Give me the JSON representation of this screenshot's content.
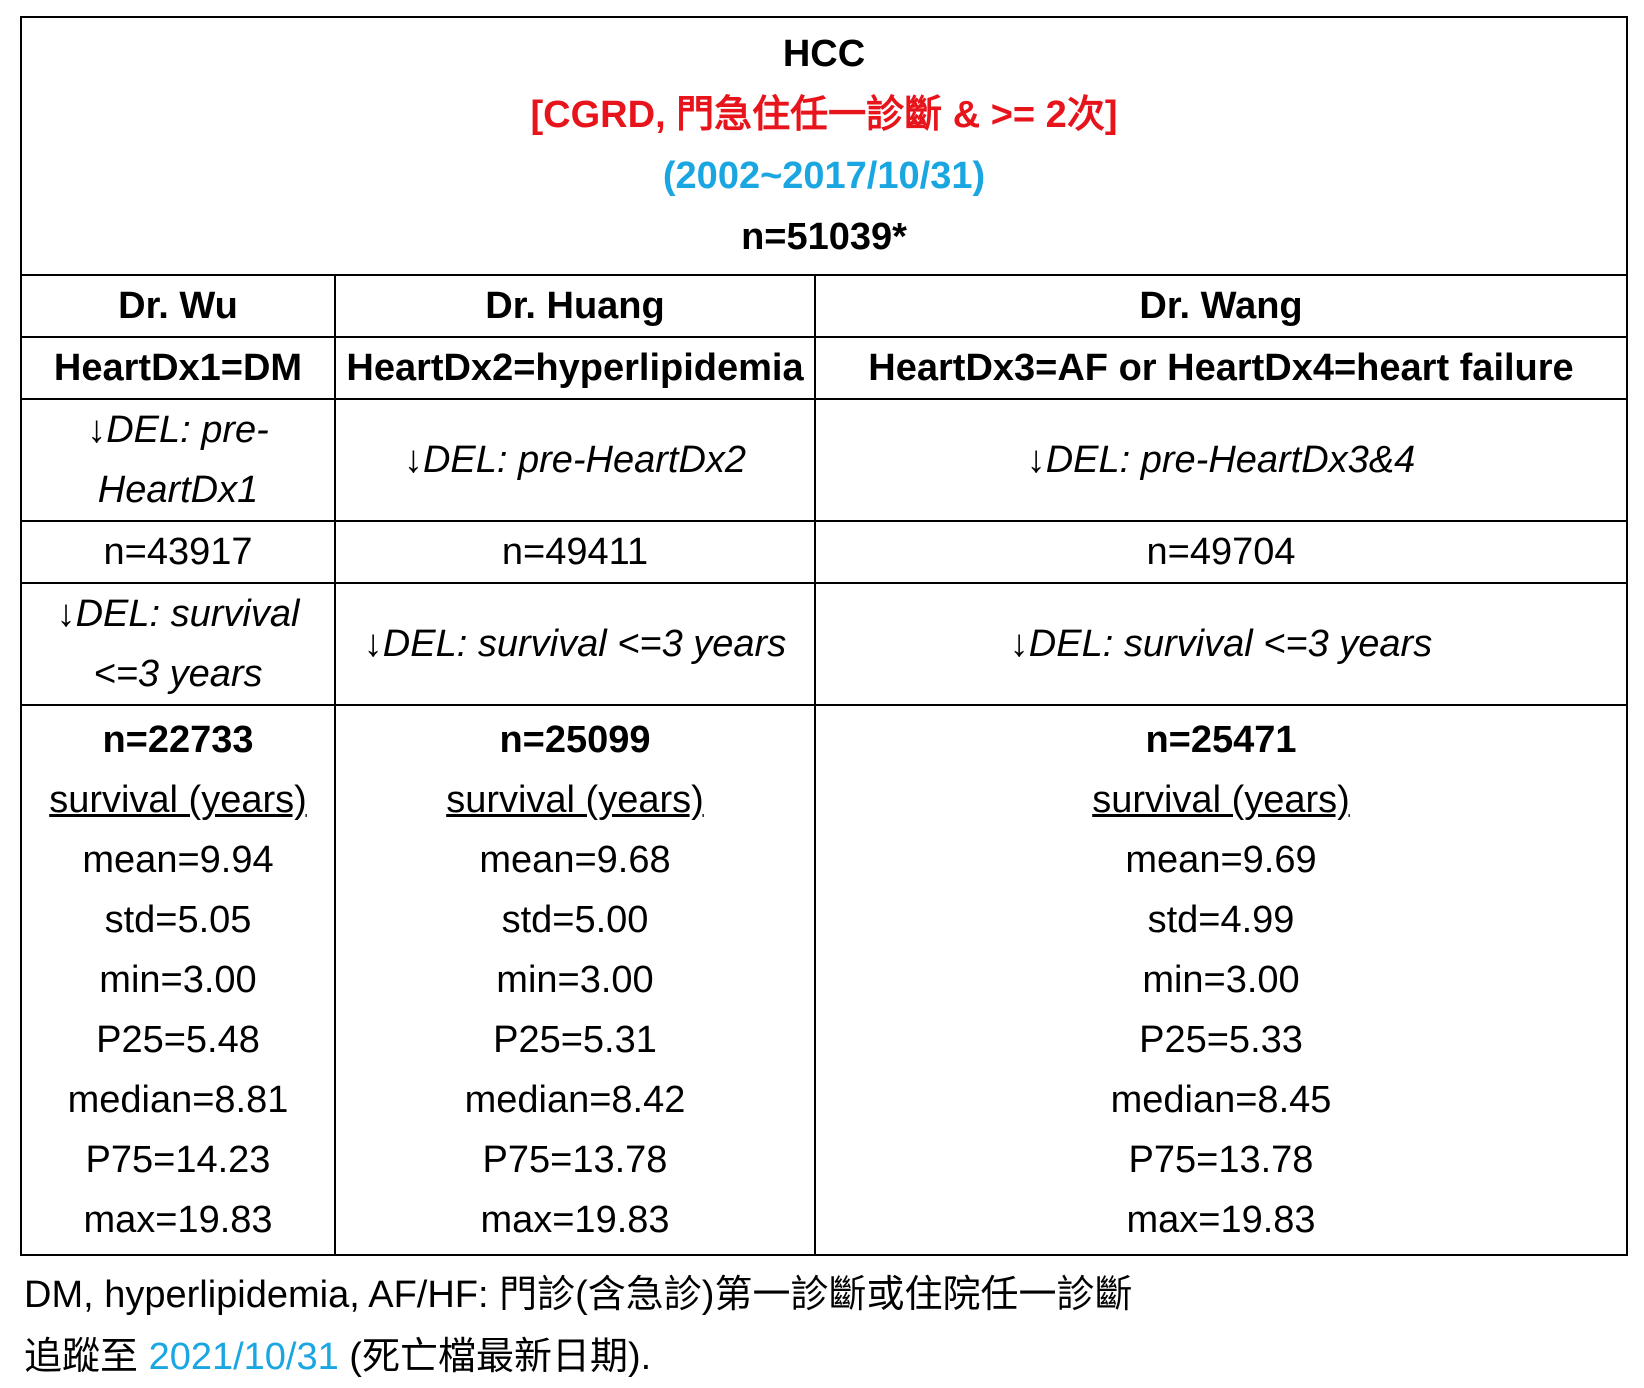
{
  "header": {
    "title": "HCC",
    "source": "[CGRD, 門急住任一診斷 & >= 2次]",
    "date_range": "(2002~2017/10/31)",
    "n": "n=51039*"
  },
  "columns": [
    {
      "doctor": "Dr. Wu",
      "dx": "HeartDx1=DM",
      "del1": "↓DEL: pre-HeartDx1",
      "n1": "n=43917",
      "del2": "↓DEL: survival <=3 years",
      "n2": "n=22733",
      "survival_label": "survival (years)",
      "mean": "mean=9.94",
      "std": "std=5.05",
      "min": "min=3.00",
      "p25": "P25=5.48",
      "median": "median=8.81",
      "p75": "P75=14.23",
      "max": "max=19.83"
    },
    {
      "doctor": "Dr. Huang",
      "dx": "HeartDx2=hyperlipidemia",
      "del1": "↓DEL: pre-HeartDx2",
      "n1": "n=49411",
      "del2": "↓DEL: survival <=3 years",
      "n2": "n=25099",
      "survival_label": "survival (years)",
      "mean": "mean=9.68",
      "std": "std=5.00",
      "min": "min=3.00",
      "p25": "P25=5.31",
      "median": "median=8.42",
      "p75": "P75=13.78",
      "max": "max=19.83"
    },
    {
      "doctor": "Dr. Wang",
      "dx": "HeartDx3=AF or HeartDx4=heart failure",
      "del1": "↓DEL: pre-HeartDx3&4",
      "n1": "n=49704",
      "del2": "↓DEL: survival <=3 years",
      "n2": "n=25471",
      "survival_label": "survival (years)",
      "mean": "mean=9.69",
      "std": "std=4.99",
      "min": "min=3.00",
      "p25": "P25=5.33",
      "median": "median=8.45",
      "p75": "P75=13.78",
      "max": "max=19.83"
    }
  ],
  "footer": {
    "line1": "DM, hyperlipidemia, AF/HF: 門診(含急診)第一診斷或住院任一診斷",
    "line2_prefix": "追蹤至 ",
    "line2_date": "2021/10/31",
    "line2_suffix": " (死亡檔最新日期)."
  },
  "colors": {
    "red": "#e8141c",
    "blue": "#1aa6e0"
  }
}
